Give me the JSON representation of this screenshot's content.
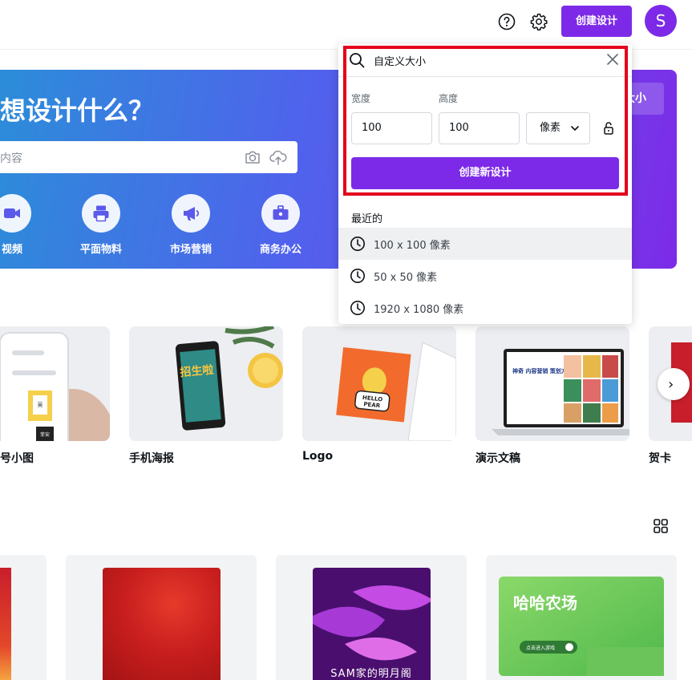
{
  "header": {
    "create_design": "创建设计",
    "avatar_initial": "S"
  },
  "hero": {
    "title": "想设计什么？",
    "search_placeholder": "内容",
    "custom_size_btn": "大小",
    "categories": [
      {
        "label": "视频",
        "icon": "video-icon"
      },
      {
        "label": "平面物料",
        "icon": "printer-icon"
      },
      {
        "label": "市场营销",
        "icon": "megaphone-icon"
      },
      {
        "label": "商务办公",
        "icon": "briefcase-icon"
      }
    ]
  },
  "templates": [
    {
      "label": "号小图",
      "thumb_text_1": "吴",
      "thumb_text_2": "菲安"
    },
    {
      "label": "手机海报",
      "thumb_text": "招生啦"
    },
    {
      "label": "Logo",
      "thumb_text_1": "HELLO",
      "thumb_text_2": "PEAR"
    },
    {
      "label": "演示文稿",
      "thumb_text": "神奇 内容营销 策划方案"
    },
    {
      "label": "贺卡"
    }
  ],
  "bottom_cards": [
    {
      "thumb_text": "SAM家的明月阁"
    },
    {
      "thumb_title": "哈哈农场",
      "thumb_button": "点击进入游戏"
    }
  ],
  "popup": {
    "search_value": "自定义大小",
    "width_label": "宽度",
    "height_label": "高度",
    "width_value": "100",
    "height_value": "100",
    "unit": "像素",
    "create_new_design": "创建新设计",
    "recent_label": "最近的",
    "recent": [
      {
        "text": "100 x 100 像素"
      },
      {
        "text": "50 x 50 像素"
      },
      {
        "text": "1920 x 1080 像素"
      }
    ]
  },
  "colors": {
    "brand_purple": "#7d2ae8",
    "highlight_red": "#e3001b"
  }
}
